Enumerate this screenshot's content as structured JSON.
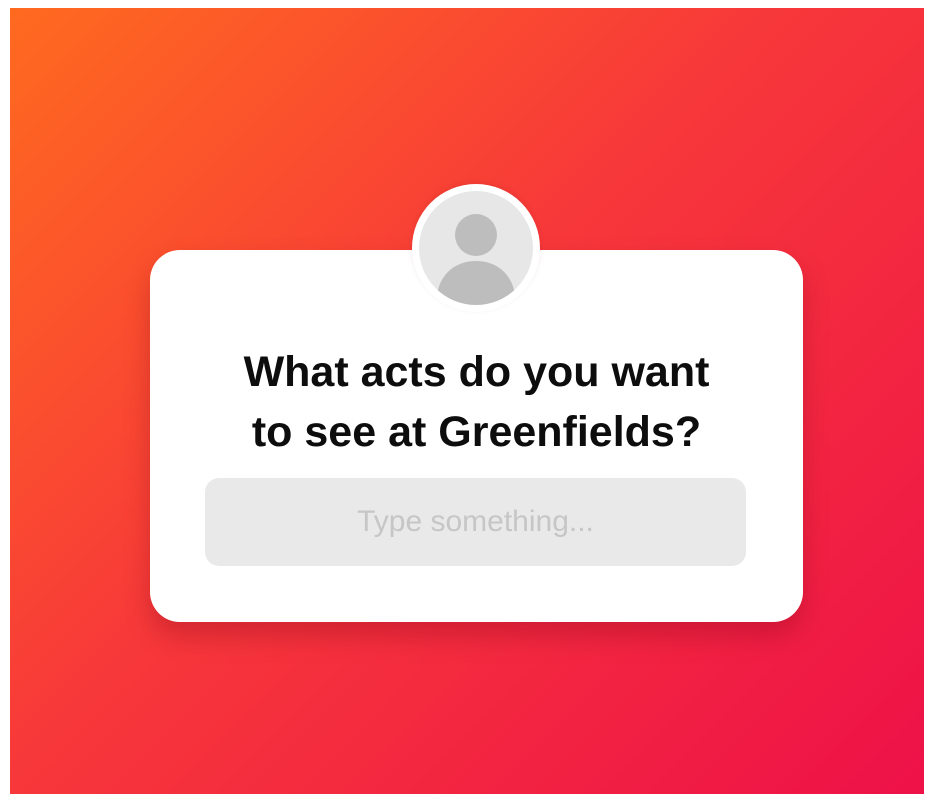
{
  "question_card": {
    "question_line_1": "What acts do you want",
    "question_line_2": "to see at Greenfields?",
    "input_placeholder": "Type something...",
    "input_value": "",
    "avatar_icon": "user-silhouette-icon"
  },
  "colors": {
    "gradient_start": "#ff6a1f",
    "gradient_mid": "#f7383a",
    "gradient_end": "#ee1148",
    "card_background": "#ffffff",
    "input_background": "#e9e9e9",
    "placeholder_text": "#c6c6c6",
    "question_text": "#0d0d0d"
  }
}
